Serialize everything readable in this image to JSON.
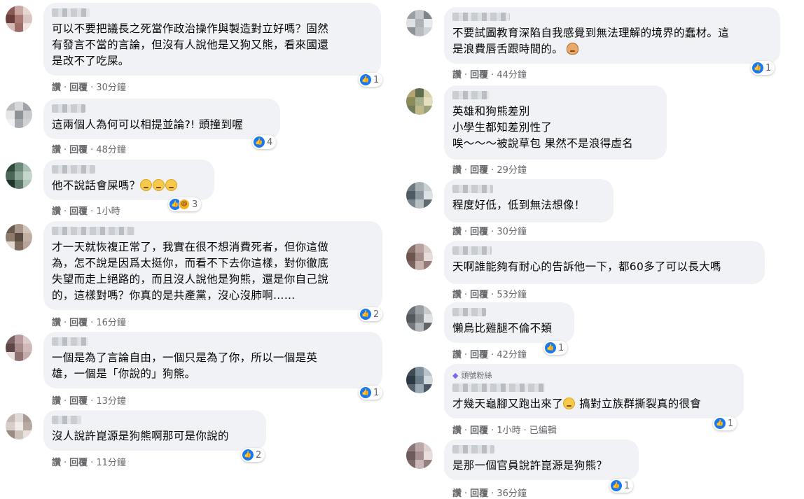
{
  "colors": {
    "bubble": "#f0f2f5",
    "like": "#1877f2",
    "meta": "#65676b"
  },
  "labels": {
    "like": "讚",
    "reply": "回覆",
    "sep": "·",
    "edited": "已編輯"
  },
  "left": [
    {
      "lines": "可以不要把議長之死當作政治操作與製造對立好嗎？固然\n有發言不當的言論，但沒有人說他是又狗又熊，看來國還\n是改不了吃屎。",
      "time": "30分鐘",
      "reactions": {
        "count": "1",
        "types": [
          "like"
        ]
      }
    },
    {
      "lines": "這兩個人為何可以相提並論?! 頭撞到喔",
      "time": "48分鐘",
      "reactions": {
        "count": "4",
        "types": [
          "like"
        ]
      }
    },
    {
      "lines": "他不說話會屎嗎？",
      "emojis": 3,
      "time": "1小時",
      "reactions": {
        "count": "3",
        "types": [
          "like",
          "haha"
        ]
      }
    },
    {
      "lines": "才一天就恢複正常了，我實在很不想消費死者，但你這做\n為，怎不說是因爲太挺你，而看不下去你這樣，對你徹底\n失望而走上絕路的，而且沒人說他是狗熊，還是你自己說\n的，這樣對嗎？你真的是共產黨，沒心沒肺啊……",
      "time": "16分鐘",
      "reactions": {
        "count": "2",
        "types": [
          "like"
        ]
      }
    },
    {
      "lines": "一個是為了言論自由，一個只是為了你，所以一個是英\n雄，一個是「你說的」狗熊。",
      "time": "13分鐘",
      "reactions": {
        "count": "1",
        "types": [
          "like"
        ]
      }
    },
    {
      "lines": "沒人說許崑源是狗熊啊那可是你說的",
      "time": "11分鐘",
      "reactions": {
        "count": "2",
        "types": [
          "like"
        ]
      }
    }
  ],
  "right": [
    {
      "lines": "不要試圖教育深陷自我感覺到無法理解的境界的蠢材。這\n是浪費唇舌跟時間的。",
      "trail_emoji": "person",
      "time": "44分鐘",
      "reactions": {
        "count": "1",
        "types": [
          "like"
        ]
      }
    },
    {
      "lines": "英雄和狗熊差別\n小學生都知差別性了\n唉～～～被說草包 果然不是浪得虛名",
      "time": "29分鐘",
      "reactions": null
    },
    {
      "lines": "程度好低，低到無法想像！",
      "time": "30分鐘",
      "reactions": null
    },
    {
      "lines": "天啊誰能夠有耐心的告訴他一下，都60多了可以長大嗎",
      "time": "53分鐘",
      "reactions": null
    },
    {
      "lines": "懶鳥比雞腿不倫不類",
      "time": "42分鐘",
      "reactions": {
        "count": "1",
        "types": [
          "like"
        ]
      }
    },
    {
      "badge": "頭號粉絲",
      "lines": "才幾天龜腳又跑出來了",
      "mid_emoji": true,
      "lines_after": " 搞對立族群撕裂真的很會",
      "time": "1小時",
      "edited": true,
      "reactions": {
        "count": "1",
        "types": [
          "like"
        ]
      }
    },
    {
      "lines": "是那一個官員說許崑源是狗熊？",
      "time": "36分鐘",
      "reactions": {
        "count": "1",
        "types": [
          "like"
        ]
      }
    }
  ]
}
